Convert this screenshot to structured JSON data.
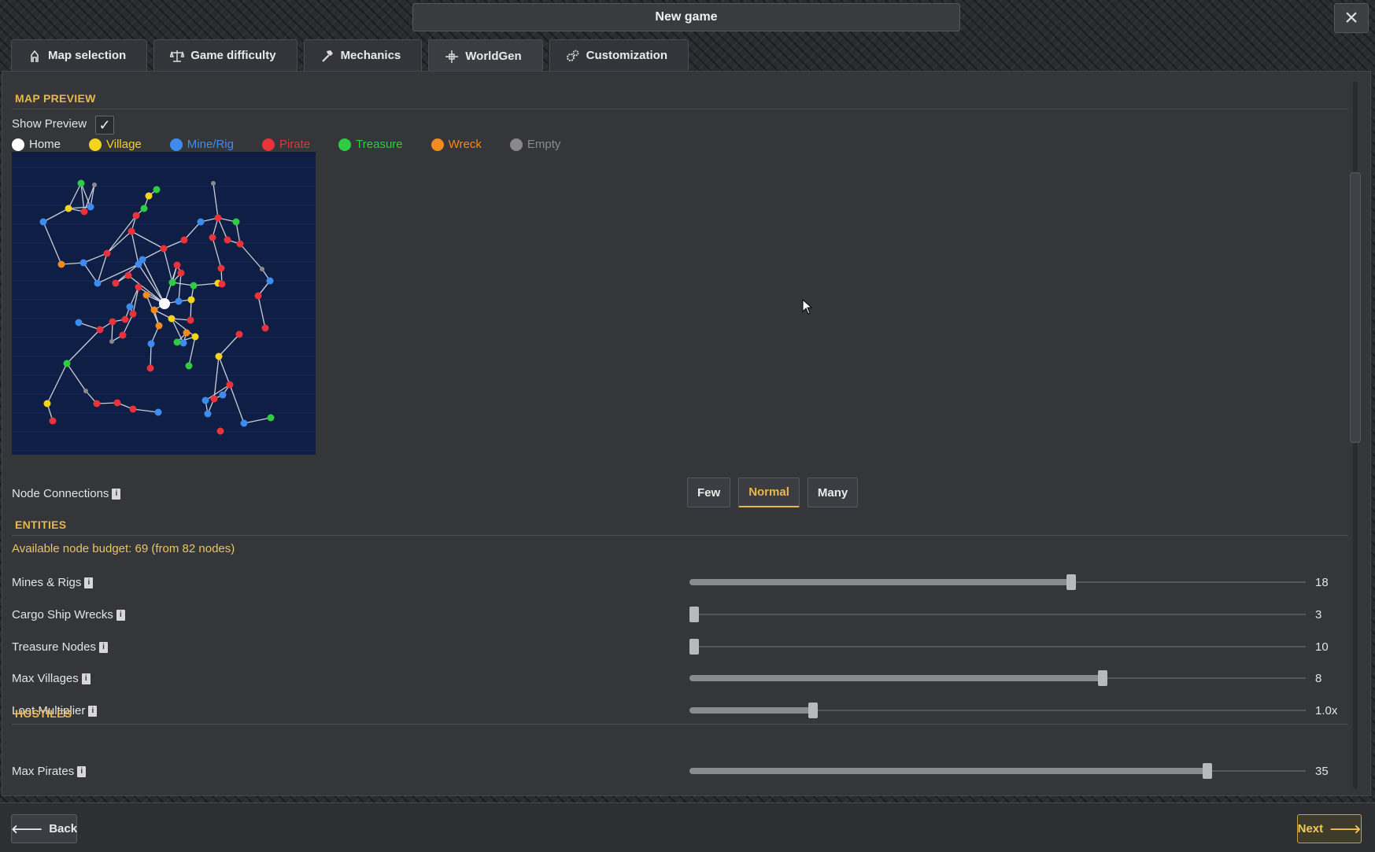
{
  "window": {
    "title": "New game",
    "close_icon": "×"
  },
  "tabs": [
    {
      "label": "Map selection",
      "icon": "map-marker-icon"
    },
    {
      "label": "Game difficulty",
      "icon": "scales-icon"
    },
    {
      "label": "Mechanics",
      "icon": "hammer-icon"
    },
    {
      "label": "WorldGen",
      "icon": "crosshair-icon",
      "active": true
    },
    {
      "label": "Customization",
      "icon": "gears-icon"
    }
  ],
  "map_preview": {
    "section_title": "MAP PREVIEW",
    "show_preview_label": "Show Preview",
    "show_preview_checked": true,
    "check_glyph": "✓",
    "legend": [
      {
        "label": "Home",
        "color": "#ffffff"
      },
      {
        "label": "Village",
        "color": "#f5d31f"
      },
      {
        "label": "Mine/Rig",
        "color": "#3f8cf0"
      },
      {
        "label": "Pirate",
        "color": "#e8333a"
      },
      {
        "label": "Treasure",
        "color": "#2ecc40"
      },
      {
        "label": "Wreck",
        "color": "#f38b1f"
      },
      {
        "label": "Empty",
        "color": "#8a8a8a"
      }
    ],
    "background_color": "#0f1e44"
  },
  "node_connections": {
    "label": "Node Connections",
    "options": [
      "Few",
      "Normal",
      "Many"
    ],
    "selected": "Normal"
  },
  "entities": {
    "section_title": "ENTITIES",
    "budget_text": "Available node budget: 69 (from 82 nodes)",
    "sliders": [
      {
        "label": "Mines & Rigs",
        "value_text": "18",
        "fraction": 0.62
      },
      {
        "label": "Cargo Ship Wrecks",
        "value_text": "3",
        "fraction": 0.0
      },
      {
        "label": "Treasure Nodes",
        "value_text": "10",
        "fraction": 0.0
      },
      {
        "label": "Max Villages",
        "value_text": "8",
        "fraction": 0.67
      },
      {
        "label": "Loot Multiplier",
        "value_text": "1.0x",
        "fraction": 0.2
      }
    ]
  },
  "hostiles": {
    "section_title": "HOSTILES",
    "sliders": [
      {
        "label": "Max Pirates",
        "value_text": "35",
        "fraction": 0.84
      }
    ]
  },
  "info_glyph": "i",
  "footer": {
    "back_label": "Back",
    "next_label": "Next",
    "back_icon": "🡐",
    "next_icon": "🡒"
  },
  "colors": {
    "accent": "#e8b84a",
    "panel": "#34363a"
  }
}
